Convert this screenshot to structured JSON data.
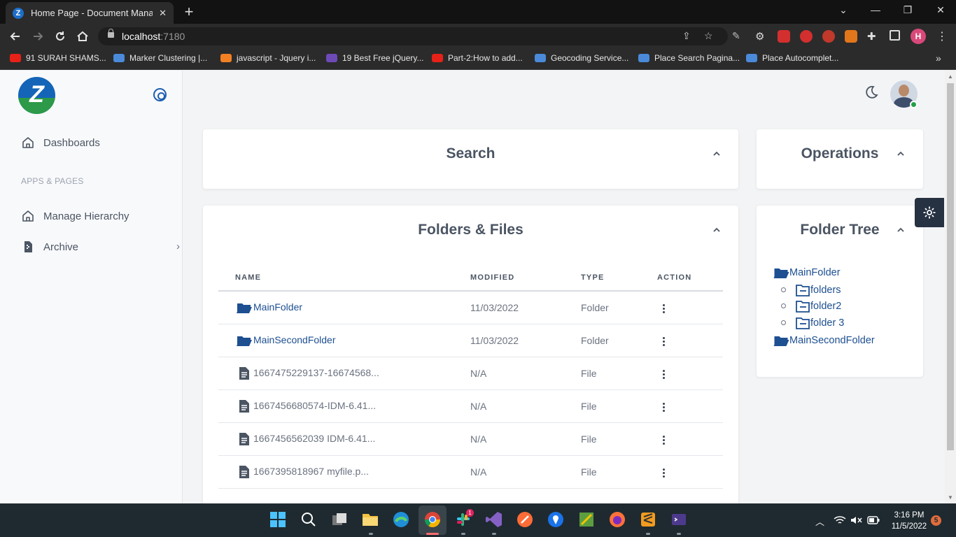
{
  "browser": {
    "tab_title": "Home Page - Document Manage",
    "favicon_letter": "Z",
    "new_tab": "+",
    "url_host": "localhost",
    "url_port": ":7180",
    "profile_initial": "H",
    "bookmarks": [
      {
        "label": "91 SURAH SHAMS...",
        "icon_color": "#e62117"
      },
      {
        "label": "Marker Clustering |...",
        "icon_color": "#4a8ad9"
      },
      {
        "label": "javascript - Jquery i...",
        "icon_color": "#f48024"
      },
      {
        "label": "19 Best Free jQuery...",
        "icon_color": "#6d4ab8"
      },
      {
        "label": "Part-2:How to add...",
        "icon_color": "#e62117"
      },
      {
        "label": "Geocoding Service...",
        "icon_color": "#4a8ad9"
      },
      {
        "label": "Place Search Pagina...",
        "icon_color": "#4a8ad9"
      },
      {
        "label": "Place Autocomplet...",
        "icon_color": "#4a8ad9"
      }
    ]
  },
  "sidebar": {
    "logo_letter": "Z",
    "items": [
      {
        "label": "Dashboards",
        "icon": "home-icon"
      },
      {
        "label": "Manage Hierarchy",
        "icon": "home-icon"
      },
      {
        "label": "Archive",
        "icon": "archive-icon"
      }
    ],
    "section_label": "APPS & PAGES"
  },
  "search_card": {
    "title": "Search"
  },
  "operations_card": {
    "title": "Operations"
  },
  "files_card": {
    "title": "Folders & Files",
    "columns": [
      "NAME",
      "MODIFIED",
      "TYPE",
      "ACTION"
    ],
    "rows": [
      {
        "name": "MainFolder",
        "modified": "11/03/2022",
        "type": "Folder",
        "kind": "folder"
      },
      {
        "name": "MainSecondFolder",
        "modified": "11/03/2022",
        "type": "Folder",
        "kind": "folder"
      },
      {
        "name": "1667475229137-16674568...",
        "modified": "N/A",
        "type": "File",
        "kind": "file"
      },
      {
        "name": "1667456680574-IDM-6.41...",
        "modified": "N/A",
        "type": "File",
        "kind": "file"
      },
      {
        "name": "1667456562039 IDM-6.41...",
        "modified": "N/A",
        "type": "File",
        "kind": "file"
      },
      {
        "name": "1667395818967 myfile.p...",
        "modified": "N/A",
        "type": "File",
        "kind": "file"
      }
    ]
  },
  "tree_card": {
    "title": "Folder Tree",
    "root": "MainFolder",
    "children": [
      "folders",
      "folder2",
      "folder 3"
    ],
    "second_root": "MainSecondFolder"
  },
  "taskbar": {
    "time": "3:16 PM",
    "date": "11/5/2022",
    "notification_count": "5",
    "slack_badge": "1"
  },
  "colors": {
    "accent": "#1d4f91",
    "brand_blue": "#1465b8",
    "brand_green": "#2c9a48"
  }
}
